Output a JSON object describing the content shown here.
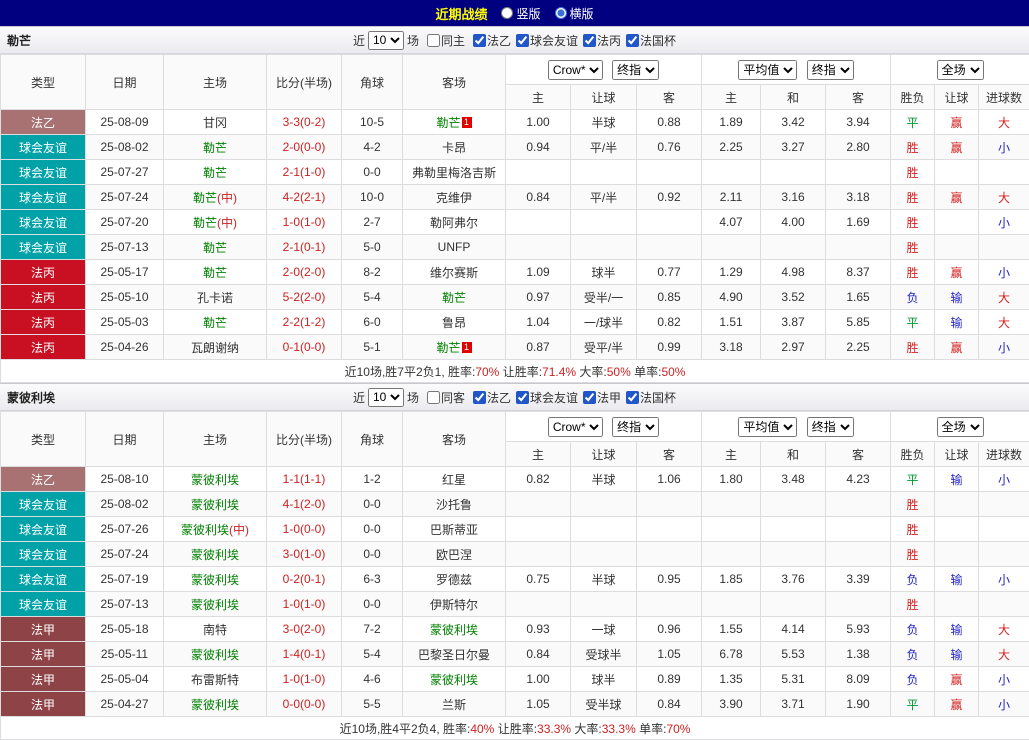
{
  "topbar": {
    "title": "近期战绩",
    "modes": [
      {
        "label": "竖版",
        "checked": false
      },
      {
        "label": "横版",
        "checked": true
      }
    ]
  },
  "filter_labels": {
    "near": "近",
    "games": "场"
  },
  "selects": {
    "company": "Crow*",
    "stage": "终指",
    "avg": "平均值",
    "avg_stage": "终指",
    "scope": "全场"
  },
  "headers": {
    "type": "类型",
    "date": "日期",
    "home": "主场",
    "score": "比分(半场)",
    "corner": "角球",
    "away": "客场",
    "h_home": "主",
    "h_handicap": "让球",
    "h_away": "客",
    "a_home": "主",
    "a_draw": "和",
    "a_away": "客",
    "r_wdl": "胜负",
    "r_handicap": "让球",
    "r_goals": "进球数"
  },
  "league_colors": {
    "法乙": "#a87272",
    "球会友谊": "#00a2a8",
    "法丙": "#c81022",
    "法甲": "#8e4347"
  },
  "result_colors": {
    "胜": "#d42222",
    "平": "#009933",
    "负": "#2222cc",
    "赢": "#d42222",
    "输": "#2222cc",
    "大": "#d42222",
    "小": "#2222cc"
  },
  "text_colors": {
    "team": "#008000",
    "neutral": "#cc2222",
    "score": "#cc2222",
    "summary_value": "#cc2222"
  },
  "sections": [
    {
      "team": "勒芒",
      "filter": {
        "count": "10",
        "same": {
          "label": "同主",
          "checked": false
        },
        "leagues": [
          {
            "label": "法乙",
            "checked": true
          },
          {
            "label": "球会友谊",
            "checked": true
          },
          {
            "label": "法丙",
            "checked": true
          },
          {
            "label": "法国杯",
            "checked": true
          }
        ]
      },
      "rows": [
        {
          "type": "法乙",
          "date": "25-08-09",
          "home": "甘冈",
          "score": "3-3(0-2)",
          "corner": "10-5",
          "away": "勒芒",
          "away_green": true,
          "away_badge": "1",
          "o1": "1.00",
          "hc": "半球",
          "o2": "0.88",
          "a1": "1.89",
          "a2": "3.42",
          "a3": "3.94",
          "r1": "平",
          "r2": "赢",
          "r3": "大"
        },
        {
          "type": "球会友谊",
          "date": "25-08-02",
          "home": "勒芒",
          "home_green": true,
          "score": "2-0(0-0)",
          "corner": "4-2",
          "away": "卡昂",
          "o1": "0.94",
          "hc": "平/半",
          "o2": "0.76",
          "a1": "2.25",
          "a2": "3.27",
          "a3": "2.80",
          "r1": "胜",
          "r2": "赢",
          "r3": "小"
        },
        {
          "type": "球会友谊",
          "date": "25-07-27",
          "home": "勒芒",
          "home_green": true,
          "score": "2-1(1-0)",
          "corner": "0-0",
          "away": "弗勒里梅洛吉斯",
          "r1": "胜"
        },
        {
          "type": "球会友谊",
          "date": "25-07-24",
          "home": "勒芒",
          "home_suffix": "(中)",
          "home_green": true,
          "score": "4-2(2-1)",
          "corner": "10-0",
          "away": "克维伊",
          "o1": "0.84",
          "hc": "平/半",
          "o2": "0.92",
          "a1": "2.11",
          "a2": "3.16",
          "a3": "3.18",
          "r1": "胜",
          "r2": "赢",
          "r3": "大"
        },
        {
          "type": "球会友谊",
          "date": "25-07-20",
          "home": "勒芒",
          "home_suffix": "(中)",
          "home_green": true,
          "score": "1-0(1-0)",
          "corner": "2-7",
          "away": "勒阿弗尔",
          "a1": "4.07",
          "a2": "4.00",
          "a3": "1.69",
          "r1": "胜",
          "r3": "小"
        },
        {
          "type": "球会友谊",
          "date": "25-07-13",
          "home": "勒芒",
          "home_green": true,
          "score": "2-1(0-1)",
          "corner": "5-0",
          "away": "UNFP",
          "r1": "胜"
        },
        {
          "type": "法丙",
          "date": "25-05-17",
          "home": "勒芒",
          "home_green": true,
          "score": "2-0(2-0)",
          "corner": "8-2",
          "away": "维尔赛斯",
          "o1": "1.09",
          "hc": "球半",
          "o2": "0.77",
          "a1": "1.29",
          "a2": "4.98",
          "a3": "8.37",
          "r1": "胜",
          "r2": "赢",
          "r3": "小"
        },
        {
          "type": "法丙",
          "date": "25-05-10",
          "home": "孔卡诺",
          "score": "5-2(2-0)",
          "corner": "5-4",
          "away": "勒芒",
          "away_green": true,
          "o1": "0.97",
          "hc": "受半/一",
          "o2": "0.85",
          "a1": "4.90",
          "a2": "3.52",
          "a3": "1.65",
          "r1": "负",
          "r2": "输",
          "r3": "大"
        },
        {
          "type": "法丙",
          "date": "25-05-03",
          "home": "勒芒",
          "home_green": true,
          "score": "2-2(1-2)",
          "corner": "6-0",
          "away": "鲁昂",
          "o1": "1.04",
          "hc": "一/球半",
          "o2": "0.82",
          "a1": "1.51",
          "a2": "3.87",
          "a3": "5.85",
          "r1": "平",
          "r2": "输",
          "r3": "大"
        },
        {
          "type": "法丙",
          "date": "25-04-26",
          "home": "瓦朗谢纳",
          "score": "0-1(0-0)",
          "corner": "5-1",
          "away": "勒芒",
          "away_green": true,
          "away_badge": "1",
          "o1": "0.87",
          "hc": "受平/半",
          "o2": "0.99",
          "a1": "3.18",
          "a2": "2.97",
          "a3": "2.25",
          "r1": "胜",
          "r2": "赢",
          "r3": "小"
        }
      ],
      "summary": [
        {
          "t": "近10场,胜7平2负1, 胜率:"
        },
        {
          "t": "70%",
          "red": true
        },
        {
          "t": " 让胜率:"
        },
        {
          "t": "71.4%",
          "red": true
        },
        {
          "t": " 大率:"
        },
        {
          "t": "50%",
          "red": true
        },
        {
          "t": " 单率:"
        },
        {
          "t": "50%",
          "red": true
        }
      ]
    },
    {
      "team": "蒙彼利埃",
      "filter": {
        "count": "10",
        "same": {
          "label": "同客",
          "checked": false
        },
        "leagues": [
          {
            "label": "法乙",
            "checked": true
          },
          {
            "label": "球会友谊",
            "checked": true
          },
          {
            "label": "法甲",
            "checked": true
          },
          {
            "label": "法国杯",
            "checked": true
          }
        ]
      },
      "rows": [
        {
          "type": "法乙",
          "date": "25-08-10",
          "home": "蒙彼利埃",
          "home_green": true,
          "score": "1-1(1-1)",
          "corner": "1-2",
          "away": "红星",
          "o1": "0.82",
          "hc": "半球",
          "o2": "1.06",
          "a1": "1.80",
          "a2": "3.48",
          "a3": "4.23",
          "r1": "平",
          "r2": "输",
          "r3": "小"
        },
        {
          "type": "球会友谊",
          "date": "25-08-02",
          "home": "蒙彼利埃",
          "home_green": true,
          "score": "4-1(2-0)",
          "corner": "0-0",
          "away": "沙托鲁",
          "r1": "胜"
        },
        {
          "type": "球会友谊",
          "date": "25-07-26",
          "home": "蒙彼利埃",
          "home_suffix": "(中)",
          "home_green": true,
          "score": "1-0(0-0)",
          "corner": "0-0",
          "away": "巴斯蒂亚",
          "r1": "胜"
        },
        {
          "type": "球会友谊",
          "date": "25-07-24",
          "home": "蒙彼利埃",
          "home_green": true,
          "score": "3-0(1-0)",
          "corner": "0-0",
          "away": "欧巴涅",
          "r1": "胜"
        },
        {
          "type": "球会友谊",
          "date": "25-07-19",
          "home": "蒙彼利埃",
          "home_green": true,
          "score": "0-2(0-1)",
          "corner": "6-3",
          "away": "罗德兹",
          "o1": "0.75",
          "hc": "半球",
          "o2": "0.95",
          "a1": "1.85",
          "a2": "3.76",
          "a3": "3.39",
          "r1": "负",
          "r2": "输",
          "r3": "小"
        },
        {
          "type": "球会友谊",
          "date": "25-07-13",
          "home": "蒙彼利埃",
          "home_green": true,
          "score": "1-0(1-0)",
          "corner": "0-0",
          "away": "伊斯特尔",
          "r1": "胜"
        },
        {
          "type": "法甲",
          "date": "25-05-18",
          "home": "南特",
          "score": "3-0(2-0)",
          "corner": "7-2",
          "away": "蒙彼利埃",
          "away_green": true,
          "o1": "0.93",
          "hc": "一球",
          "o2": "0.96",
          "a1": "1.55",
          "a2": "4.14",
          "a3": "5.93",
          "r1": "负",
          "r2": "输",
          "r3": "大"
        },
        {
          "type": "法甲",
          "date": "25-05-11",
          "home": "蒙彼利埃",
          "home_green": true,
          "score": "1-4(0-1)",
          "corner": "5-4",
          "away": "巴黎圣日尔曼",
          "o1": "0.84",
          "hc": "受球半",
          "o2": "1.05",
          "a1": "6.78",
          "a2": "5.53",
          "a3": "1.38",
          "r1": "负",
          "r2": "输",
          "r3": "大"
        },
        {
          "type": "法甲",
          "date": "25-05-04",
          "home": "布雷斯特",
          "score": "1-0(1-0)",
          "corner": "4-6",
          "away": "蒙彼利埃",
          "away_green": true,
          "o1": "1.00",
          "hc": "球半",
          "o2": "0.89",
          "a1": "1.35",
          "a2": "5.31",
          "a3": "8.09",
          "r1": "负",
          "r2": "赢",
          "r3": "小"
        },
        {
          "type": "法甲",
          "date": "25-04-27",
          "home": "蒙彼利埃",
          "home_green": true,
          "score": "0-0(0-0)",
          "corner": "5-5",
          "away": "兰斯",
          "o1": "1.05",
          "hc": "受半球",
          "o2": "0.84",
          "a1": "3.90",
          "a2": "3.71",
          "a3": "1.90",
          "r1": "平",
          "r2": "赢",
          "r3": "小"
        }
      ],
      "summary": [
        {
          "t": "近10场,胜4平2负4, 胜率:"
        },
        {
          "t": "40%",
          "red": true
        },
        {
          "t": " 让胜率:"
        },
        {
          "t": "33.3%",
          "red": true
        },
        {
          "t": " 大率:"
        },
        {
          "t": "33.3%",
          "red": true
        },
        {
          "t": " 单率:"
        },
        {
          "t": "70%",
          "red": true
        }
      ]
    }
  ]
}
